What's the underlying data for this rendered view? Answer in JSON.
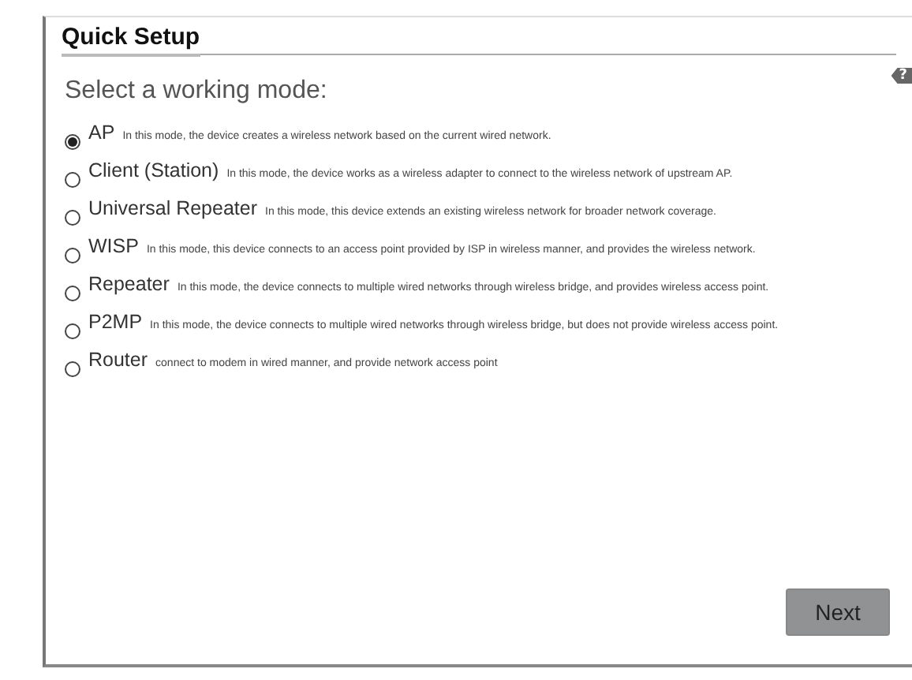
{
  "title": "Quick Setup",
  "help": "?",
  "heading": "Select a working mode:",
  "modes": [
    {
      "label": "AP",
      "description": "In this mode, the device creates a wireless network based on the current wired network.",
      "selected": true
    },
    {
      "label": "Client (Station)",
      "description": "In this mode, the device works as a wireless adapter to connect to the wireless network of upstream AP.",
      "selected": false
    },
    {
      "label": "Universal Repeater",
      "description": "In this mode, this device extends an existing wireless network for broader network coverage.",
      "selected": false
    },
    {
      "label": "WISP",
      "description": "In this mode, this device connects to an access point provided by ISP in wireless manner, and provides the wireless network.",
      "selected": false
    },
    {
      "label": "Repeater",
      "description": "In this mode, the device connects to multiple wired networks through wireless bridge, and provides wireless access point.",
      "selected": false
    },
    {
      "label": "P2MP",
      "description": "In this mode, the device connects to multiple wired networks through wireless bridge, but does not provide wireless access point.",
      "selected": false
    },
    {
      "label": "Router",
      "description": "connect to modem in wired manner, and provide network access point",
      "selected": false
    }
  ],
  "next_button": "Next"
}
